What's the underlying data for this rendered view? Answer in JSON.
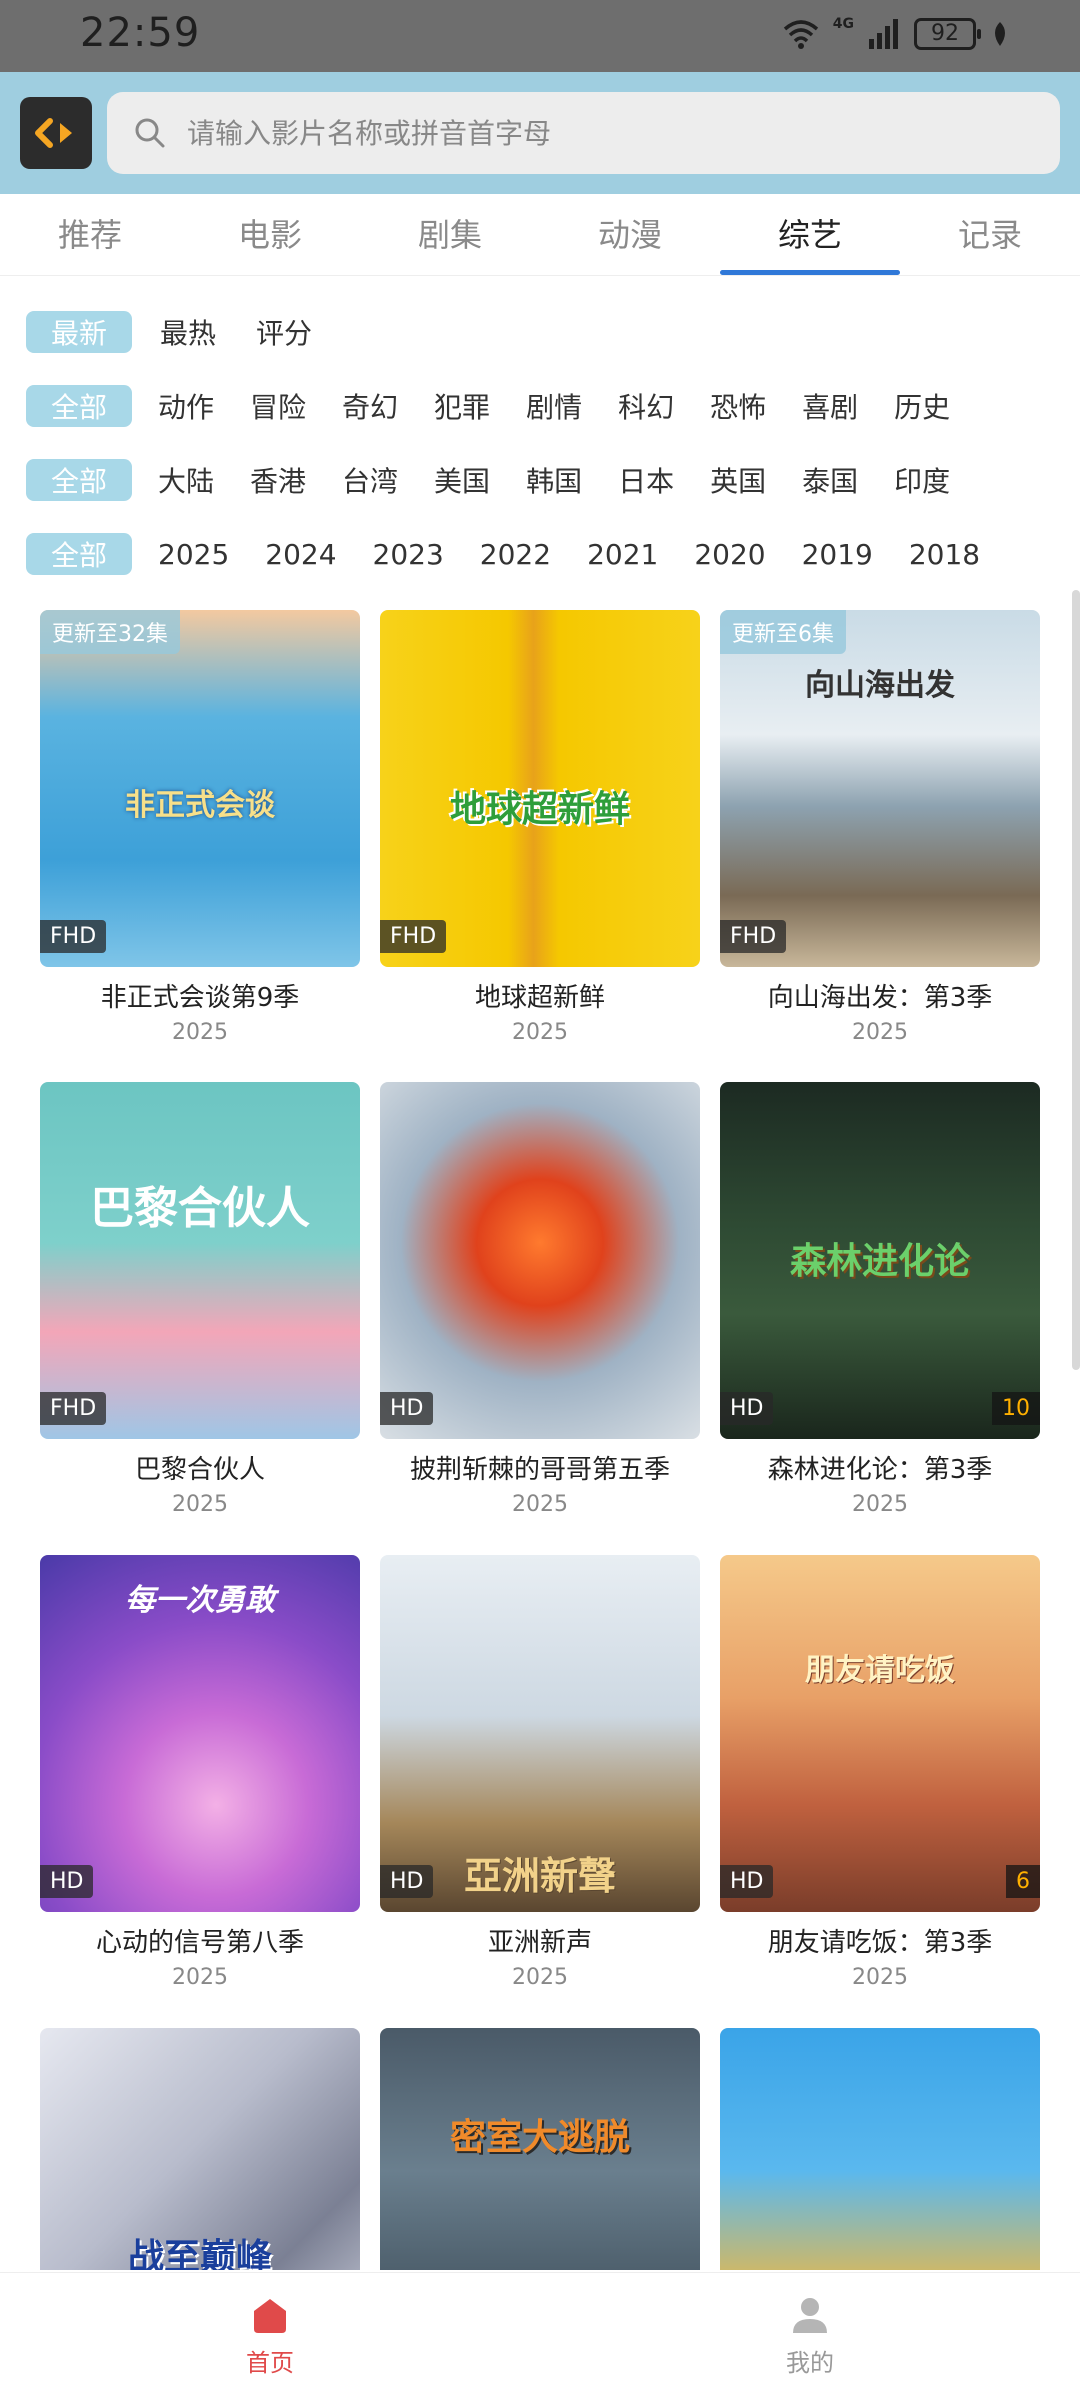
{
  "status_bar": {
    "time": "22:59",
    "network": "4G",
    "battery": "92"
  },
  "search": {
    "placeholder": "请输入影片名称或拼音首字母"
  },
  "tabs": [
    {
      "label": "推荐"
    },
    {
      "label": "电影"
    },
    {
      "label": "剧集"
    },
    {
      "label": "动漫"
    },
    {
      "label": "综艺"
    },
    {
      "label": "记录"
    }
  ],
  "active_tab": "综艺",
  "filters": {
    "sort": {
      "selected": "最新",
      "options": [
        "最热",
        "评分"
      ]
    },
    "genre": {
      "selected": "全部",
      "options": [
        "动作",
        "冒险",
        "奇幻",
        "犯罪",
        "剧情",
        "科幻",
        "恐怖",
        "喜剧",
        "历史"
      ]
    },
    "region": {
      "selected": "全部",
      "options": [
        "大陆",
        "香港",
        "台湾",
        "美国",
        "韩国",
        "日本",
        "英国",
        "泰国",
        "印度"
      ]
    },
    "year": {
      "selected": "全部",
      "options": [
        "2025",
        "2024",
        "2023",
        "2022",
        "2021",
        "2020",
        "2019",
        "2018"
      ]
    }
  },
  "cards": [
    {
      "title": "非正式会谈第9季",
      "year": "2025",
      "quality": "FHD",
      "update": "更新至32集",
      "poster_text": "非正式会谈",
      "episodes": ""
    },
    {
      "title": "地球超新鲜",
      "year": "2025",
      "quality": "FHD",
      "update": "",
      "poster_text": "地球超新鲜",
      "episodes": ""
    },
    {
      "title": "向山海出发：第3季",
      "year": "2025",
      "quality": "FHD",
      "update": "更新至6集",
      "poster_text": "向山海出发",
      "episodes": ""
    },
    {
      "title": "巴黎合伙人",
      "year": "2025",
      "quality": "FHD",
      "update": "",
      "poster_text": "巴黎合伙人",
      "episodes": ""
    },
    {
      "title": "披荆斩棘的哥哥第五季",
      "year": "2025",
      "quality": "HD",
      "update": "",
      "poster_text": "",
      "episodes": ""
    },
    {
      "title": "森林进化论：第3季",
      "year": "2025",
      "quality": "HD",
      "update": "",
      "poster_text": "森林进化论",
      "episodes": "10"
    },
    {
      "title": "心动的信号第八季",
      "year": "2025",
      "quality": "HD",
      "update": "",
      "poster_text": "每一次勇敢",
      "episodes": ""
    },
    {
      "title": "亚洲新声",
      "year": "2025",
      "quality": "HD",
      "update": "",
      "poster_text": "亞洲新聲",
      "episodes": ""
    },
    {
      "title": "朋友请吃饭：第3季",
      "year": "2025",
      "quality": "HD",
      "update": "",
      "poster_text": "朋友请吃饭",
      "episodes": "6"
    },
    {
      "title": "",
      "year": "",
      "quality": "",
      "update": "",
      "poster_text": "战至巅峰",
      "episodes": ""
    },
    {
      "title": "",
      "year": "",
      "quality": "",
      "update": "",
      "poster_text": "密室大逃脱",
      "episodes": ""
    },
    {
      "title": "",
      "year": "",
      "quality": "",
      "update": "",
      "poster_text": "",
      "episodes": ""
    }
  ],
  "bottom_nav": [
    {
      "label": "首页"
    },
    {
      "label": "我的"
    }
  ],
  "colors": {
    "header_bg": "#9fcee0",
    "chip_bg": "#a8d8e8",
    "tab_indicator": "#2f78d8",
    "active_nav": "#e04a4a"
  }
}
